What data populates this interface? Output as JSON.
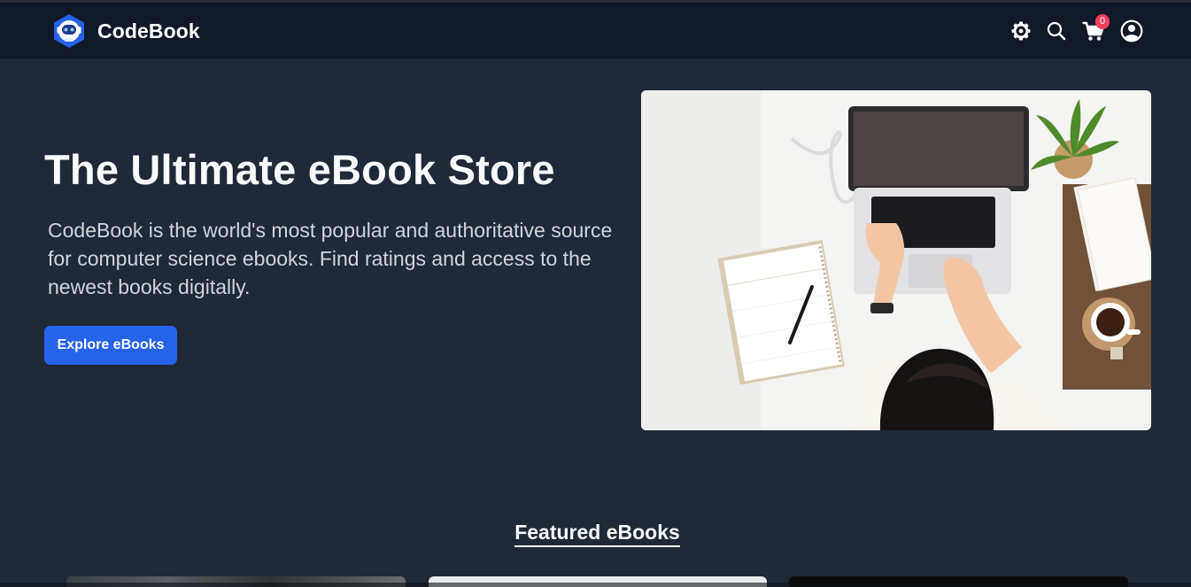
{
  "brand": {
    "name": "CodeBook",
    "logo_icon": "astronaut-logo-icon"
  },
  "nav": {
    "settings_icon": "gear-icon",
    "search_icon": "search-icon",
    "cart_icon": "cart-icon",
    "cart_count": "0",
    "account_icon": "user-circle-icon"
  },
  "hero": {
    "title": "The Ultimate eBook Store",
    "description": "CodeBook is the world's most popular and authoritative source for computer science ebooks. Find ratings and access to the newest books digitally.",
    "cta_label": "Explore eBooks",
    "image_alt": "Person typing on a laptop at a white desk"
  },
  "featured": {
    "title": "Featured eBooks"
  },
  "colors": {
    "background": "#1f2937",
    "navbar": "#111827",
    "accent": "#2563eb",
    "badge": "#f43f5e"
  }
}
